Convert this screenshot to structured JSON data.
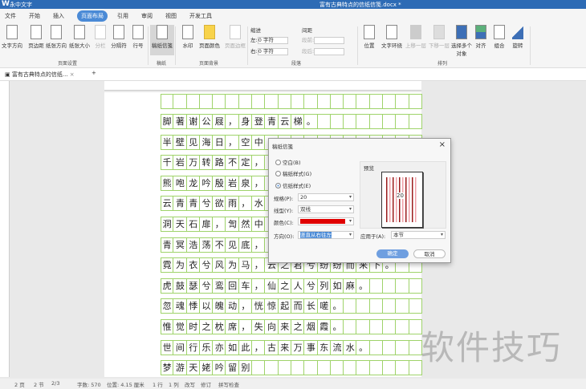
{
  "app": {
    "title": "永中文字",
    "document": "富有古典特点的信纸信笺.docx *"
  },
  "menu": [
    "文件",
    "开始",
    "插入",
    "页面布局",
    "引用",
    "审阅",
    "视图",
    "开发工具"
  ],
  "ribbon": {
    "page_setup": {
      "items": [
        "文字方向",
        "页边距",
        "纸张方向",
        "纸张大小",
        "分栏",
        "分隔符",
        "行号"
      ],
      "group": "页面设置"
    },
    "manuscript": {
      "items": [
        "稿纸信笺"
      ],
      "group": "稿纸"
    },
    "background": {
      "items": [
        "水印",
        "页面颜色",
        "页面边框"
      ],
      "group": "页面背景"
    },
    "paragraph": {
      "indent_label": "缩进",
      "left_label": "左:",
      "left_value": "0 字符",
      "right_label": "右:",
      "right_value": "0 字符",
      "spacing_label": "间距",
      "before_label": "段前:",
      "after_label": "段后:",
      "group": "段落"
    },
    "arrange": {
      "items": [
        "位置",
        "文字环绕",
        "上移一层",
        "下移一层",
        "选择多个对象",
        "对齐",
        "组合",
        "旋转"
      ],
      "group": "排列"
    }
  },
  "tab": {
    "label": "富有古典特点的信纸...",
    "close": "×",
    "add": "+"
  },
  "document": {
    "lines": [
      "脚著谢公屐，身登青云梯。",
      "半壁见海日，空中",
      "千岩万转路不定，",
      "熊咆龙吟殷岩泉，",
      "云青青兮欲雨，水",
      "洞天石扉，訇然中",
      "青冥浩荡不见底，",
      "霓为衣兮风为马，云之君兮纷纷而来下。",
      "虎鼓瑟兮鸾回车，仙之人兮列如麻。",
      "忽魂悸以魄动，恍惊起而长嗟。",
      "惟觉时之枕席，失向来之烟霞。",
      "世间行乐亦如此，古来万事东流水。",
      "梦游天姥吟留别"
    ]
  },
  "dialog": {
    "title": "稿纸信笺",
    "close": "×",
    "options": [
      "空白(B)",
      "稿纸样式(G)",
      "信纸样式(E)"
    ],
    "selected_option": 2,
    "spec_label": "规格(P):",
    "spec_value": "20",
    "line_label": "线型(Y):",
    "line_value": "双线",
    "color_label": "颜色(C):",
    "color_value": "#e00000",
    "direction_label": "方向(O):",
    "direction_value": "竖直从右往左",
    "apply_label": "应用于(A):",
    "apply_value": "本节",
    "preview_label": "预览",
    "preview_number": "20",
    "ok": "确定",
    "cancel": "取消"
  },
  "status": {
    "page": "2 页",
    "section": "2 节",
    "page_of": "2/3",
    "words": "字数: 570",
    "position": "位置: 4.15 厘米",
    "row": "1 行",
    "col": "1 列",
    "overwrite": "改写",
    "revise": "修订",
    "spell": "拼写检查"
  },
  "watermark": "软件技巧"
}
